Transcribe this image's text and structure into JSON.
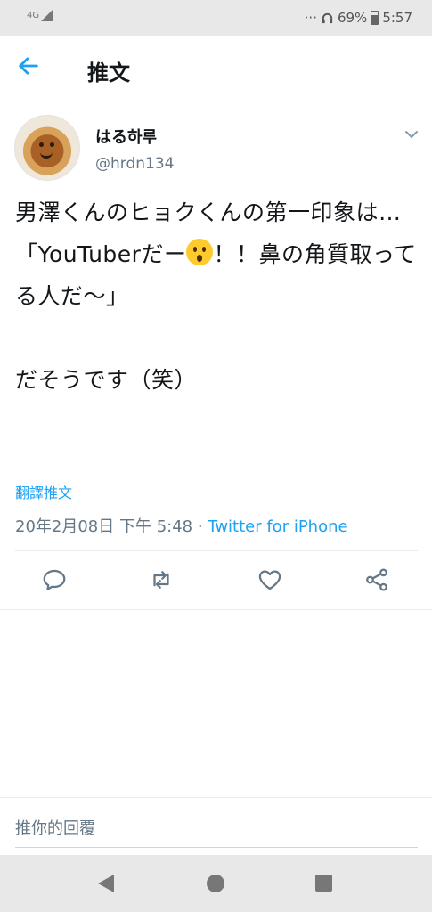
{
  "status_bar": {
    "network": "4G",
    "more_indicator": "···",
    "battery": "69%",
    "time": "5:57"
  },
  "header": {
    "title": "推文",
    "back_icon": "arrow-left-icon"
  },
  "tweet": {
    "display_name": "はる하루",
    "handle": "@hrdn134",
    "text_line1": "男澤くんのヒョクくんの第一印象は…",
    "text_line2_before_emoji": "\n「YouTuberだー",
    "emoji": "astonished-face-emoji",
    "text_line2_after_emoji": "！！鼻の角質取ってる人だ〜」\n\nだそうです（笑）",
    "translate_label": "翻譯推文",
    "timestamp": "20年2月08日 下午 5:48",
    "separator": " · ",
    "source": "Twitter for iPhone",
    "accent_color": "#1da1f2"
  },
  "actions": {
    "reply_icon": "reply-icon",
    "retweet_icon": "retweet-icon",
    "like_icon": "heart-icon",
    "share_icon": "share-icon"
  },
  "reply": {
    "placeholder": "推你的回覆"
  },
  "navbar": {
    "back_icon": "nav-back-icon",
    "home_icon": "nav-home-icon",
    "recent_icon": "nav-recent-apps-icon"
  }
}
